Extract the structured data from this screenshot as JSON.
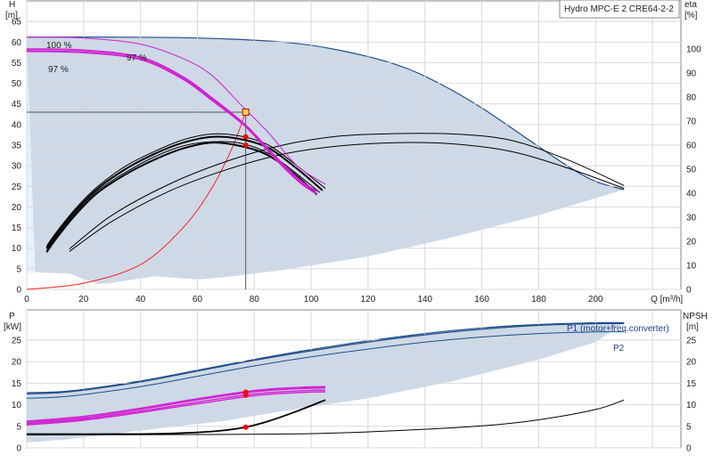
{
  "chart_data": [
    {
      "type": "line",
      "title": "Hydro MPC-E 2 CRE64-2-2",
      "xlabel": "Q [m³/h]",
      "ylabel": "H",
      "ylabel_unit": "[m]",
      "y2label": "eta",
      "y2label_unit": "[%]",
      "xlim": [
        0,
        230
      ],
      "ylim": [
        0,
        70
      ],
      "y2lim": [
        0,
        120
      ],
      "xticks": [
        "0",
        "20",
        "40",
        "60",
        "80",
        "100",
        "120",
        "140",
        "160",
        "180",
        "200",
        "Q [m³/h]"
      ],
      "yticks": [
        "0",
        "5",
        "10",
        "15",
        "20",
        "25",
        "30",
        "35",
        "40",
        "45",
        "50",
        "55",
        "60",
        "65"
      ],
      "y2ticks": [
        "0",
        "10",
        "20",
        "30",
        "40",
        "50",
        "60",
        "70",
        "80",
        "90",
        "100"
      ],
      "grid": true,
      "colors": {
        "envelope": "#cdd9e6",
        "envelope_edge": "#1f4e8c",
        "speed": "#d21fd2",
        "eff": "#000000",
        "system": "#ff2020",
        "duty": "#ffd54a"
      },
      "envelope": {
        "top": [
          [
            0,
            61.2
          ],
          [
            30,
            61.2
          ],
          [
            60,
            61
          ],
          [
            90,
            60
          ],
          [
            110,
            58
          ],
          [
            130,
            54.5
          ],
          [
            145,
            50
          ],
          [
            160,
            44
          ],
          [
            175,
            37
          ],
          [
            190,
            30
          ],
          [
            200,
            26.2
          ],
          [
            210,
            24.2
          ]
        ],
        "bottom": [
          [
            210,
            24.2
          ],
          [
            180,
            18
          ],
          [
            150,
            12.7
          ],
          [
            120,
            8
          ],
          [
            90,
            4.7
          ],
          [
            70,
            3
          ],
          [
            60,
            2.4
          ],
          [
            45,
            3.2
          ],
          [
            30,
            1.6
          ],
          [
            25,
            1.3
          ],
          [
            15,
            3.8
          ],
          [
            3,
            4.2
          ]
        ]
      },
      "speed_annotations": [
        "100 %",
        "97 %",
        "97 %"
      ],
      "speed_curves": [
        {
          "name": "100 %",
          "points": [
            [
              0,
              61.2
            ],
            [
              20,
              61
            ],
            [
              40,
              59.5
            ],
            [
              55,
              56
            ],
            [
              65,
              52
            ],
            [
              75,
              45
            ],
            [
              85,
              38
            ],
            [
              95,
              30
            ],
            [
              105,
              25.5
            ]
          ]
        },
        {
          "name": "97 %",
          "points": [
            [
              0,
              58.3
            ],
            [
              20,
              58
            ],
            [
              40,
              56.3
            ],
            [
              55,
              51.5
            ],
            [
              65,
              46.5
            ],
            [
              77,
              39.8
            ],
            [
              87,
              32.5
            ],
            [
              96,
              26.5
            ],
            [
              102,
              23.8
            ]
          ]
        },
        {
          "name": "97 %",
          "points": [
            [
              0,
              57.8
            ],
            [
              20,
              57.5
            ],
            [
              40,
              55.8
            ],
            [
              55,
              51
            ],
            [
              65,
              46
            ],
            [
              77,
              39.5
            ],
            [
              87,
              32
            ],
            [
              96,
              26
            ],
            [
              102,
              23.2
            ]
          ]
        }
      ],
      "efficiency_curves": [
        {
          "points": [
            [
              7,
              10.5
            ],
            [
              10,
              13.5
            ],
            [
              17,
              19.5
            ],
            [
              25,
              25
            ],
            [
              35,
              30
            ],
            [
              45,
              33.5
            ],
            [
              55,
              36.3
            ],
            [
              65,
              37.7
            ],
            [
              75,
              37.2
            ],
            [
              85,
              35
            ],
            [
              95,
              30
            ],
            [
              105,
              24.5
            ]
          ]
        },
        {
          "points": [
            [
              7,
              10
            ],
            [
              10,
              13
            ],
            [
              17,
              19
            ],
            [
              25,
              24.5
            ],
            [
              35,
              29.3
            ],
            [
              45,
              32.9
            ],
            [
              55,
              35.6
            ],
            [
              65,
              37
            ],
            [
              75,
              36.5
            ],
            [
              85,
              34.3
            ],
            [
              95,
              29.3
            ],
            [
              104,
              24
            ]
          ]
        },
        {
          "points": [
            [
              7,
              9.5
            ],
            [
              10,
              12.5
            ],
            [
              17,
              18.5
            ],
            [
              25,
              24
            ],
            [
              35,
              28.5
            ],
            [
              45,
              32.2
            ],
            [
              55,
              34.8
            ],
            [
              65,
              35.8
            ],
            [
              75,
              35.5
            ],
            [
              85,
              33
            ],
            [
              95,
              28
            ],
            [
              103,
              23.5
            ]
          ]
        },
        {
          "points": [
            [
              7,
              9
            ],
            [
              10,
              12
            ],
            [
              17,
              18
            ],
            [
              25,
              23.5
            ],
            [
              35,
              28
            ],
            [
              45,
              31.5
            ],
            [
              55,
              34.2
            ],
            [
              65,
              35.6
            ],
            [
              75,
              34.8
            ],
            [
              85,
              32.5
            ],
            [
              95,
              27.5
            ],
            [
              102,
              23
            ]
          ]
        },
        {
          "points": [
            [
              15,
              9.8
            ],
            [
              30,
              18
            ],
            [
              50,
              25.5
            ],
            [
              70,
              31
            ],
            [
              90,
              35
            ],
            [
              110,
              37.2
            ],
            [
              130,
              37.8
            ],
            [
              150,
              37.7
            ],
            [
              170,
              36.2
            ],
            [
              190,
              31.5
            ],
            [
              210,
              25.2
            ]
          ]
        },
        {
          "points": [
            [
              15,
              9.2
            ],
            [
              30,
              16.5
            ],
            [
              50,
              23.8
            ],
            [
              70,
              29
            ],
            [
              90,
              32.8
            ],
            [
              110,
              34.8
            ],
            [
              130,
              35.6
            ],
            [
              150,
              35.3
            ],
            [
              170,
              33.5
            ],
            [
              190,
              29.5
            ],
            [
              210,
              24.5
            ]
          ]
        }
      ],
      "system_curve": [
        [
          0,
          0
        ],
        [
          20,
          1.5
        ],
        [
          40,
          6
        ],
        [
          55,
          15
        ],
        [
          65,
          24.5
        ],
        [
          72,
          34
        ],
        [
          77,
          43
        ]
      ],
      "guide_lines": {
        "h": [
          [
            0,
            43
          ],
          [
            77,
            43
          ]
        ],
        "v": [
          [
            77,
            0
          ],
          [
            77,
            43
          ]
        ]
      },
      "operating_point": {
        "x": 77,
        "y": 43
      },
      "red_points": [
        [
          77,
          37
        ],
        [
          77,
          35
        ]
      ]
    },
    {
      "type": "line",
      "xlabel": "",
      "ylabel": "P",
      "ylabel_unit": "[kW]",
      "y2label": "NPSH",
      "y2label_unit": "[m]",
      "xlim": [
        0,
        230
      ],
      "ylim": [
        0,
        32
      ],
      "y2lim": [
        0,
        32
      ],
      "yticks": [
        "0",
        "5",
        "10",
        "15",
        "20",
        "25"
      ],
      "y2ticks": [
        "0",
        "5",
        "10",
        "15",
        "20",
        "25"
      ],
      "grid": true,
      "legend": [
        "P1 (motor+freq.converter)",
        "P2"
      ],
      "envelope": {
        "top": [
          [
            0,
            12.8
          ],
          [
            15,
            13.2
          ],
          [
            40,
            15.5
          ],
          [
            60,
            18
          ],
          [
            80,
            20.5
          ],
          [
            100,
            22.8
          ],
          [
            120,
            24.8
          ],
          [
            140,
            26.5
          ],
          [
            160,
            27.8
          ],
          [
            180,
            28.6
          ],
          [
            200,
            29
          ],
          [
            210,
            29
          ]
        ],
        "bottom": [
          [
            210,
            29
          ],
          [
            200,
            24.5
          ],
          [
            180,
            20.5
          ],
          [
            150,
            15.5
          ],
          [
            120,
            11.5
          ],
          [
            90,
            8.5
          ],
          [
            70,
            6.3
          ],
          [
            50,
            4.8
          ],
          [
            30,
            3.2
          ],
          [
            15,
            2
          ],
          [
            5,
            1.5
          ],
          [
            0,
            1.3
          ]
        ]
      },
      "p1_curve": [
        [
          0,
          12.5
        ],
        [
          15,
          13
        ],
        [
          40,
          15.3
        ],
        [
          60,
          17.8
        ],
        [
          80,
          20.3
        ],
        [
          100,
          22.5
        ],
        [
          120,
          24.5
        ],
        [
          140,
          26.2
        ],
        [
          160,
          27.5
        ],
        [
          180,
          28.4
        ],
        [
          200,
          28.8
        ],
        [
          210,
          28.8
        ]
      ],
      "p2_curve": [
        [
          0,
          11.5
        ],
        [
          15,
          12
        ],
        [
          40,
          14.2
        ],
        [
          60,
          16.6
        ],
        [
          80,
          19
        ],
        [
          100,
          21.1
        ],
        [
          120,
          22.9
        ],
        [
          140,
          24.5
        ],
        [
          160,
          25.7
        ],
        [
          180,
          26.5
        ],
        [
          200,
          26.9
        ],
        [
          210,
          26.9
        ]
      ],
      "speed_power": [
        {
          "points": [
            [
              0,
              6.2
            ],
            [
              20,
              7.3
            ],
            [
              40,
              9.2
            ],
            [
              60,
              11.4
            ],
            [
              80,
              13.3
            ],
            [
              95,
              14
            ],
            [
              105,
              14.2
            ]
          ]
        },
        {
          "points": [
            [
              0,
              5.9
            ],
            [
              20,
              7
            ],
            [
              40,
              8.9
            ],
            [
              60,
              11.1
            ],
            [
              80,
              13
            ],
            [
              95,
              13.7
            ],
            [
              105,
              13.9
            ]
          ]
        },
        {
          "points": [
            [
              0,
              5.6
            ],
            [
              20,
              6.7
            ],
            [
              40,
              8.5
            ],
            [
              60,
              10.6
            ],
            [
              80,
              12.5
            ],
            [
              95,
              13.2
            ],
            [
              105,
              13.4
            ]
          ]
        },
        {
          "points": [
            [
              0,
              5.3
            ],
            [
              20,
              6.4
            ],
            [
              40,
              8.2
            ],
            [
              60,
              10.2
            ],
            [
              80,
              12.1
            ],
            [
              95,
              12.8
            ],
            [
              105,
              13
            ]
          ]
        }
      ],
      "npsh_curves": [
        {
          "points": [
            [
              0,
              3.2
            ],
            [
              40,
              3.2
            ],
            [
              60,
              3.6
            ],
            [
              70,
              4.1
            ],
            [
              77,
              4.8
            ],
            [
              85,
              6.2
            ],
            [
              95,
              8.5
            ],
            [
              105,
              11.1
            ]
          ]
        },
        {
          "points": [
            [
              0,
              3
            ],
            [
              60,
              3.1
            ],
            [
              100,
              3.3
            ],
            [
              130,
              4
            ],
            [
              160,
              5.1
            ],
            [
              180,
              6.5
            ],
            [
              200,
              8.9
            ],
            [
              210,
              11.1
            ]
          ]
        }
      ],
      "red_points": [
        [
          77,
          12.9
        ],
        [
          77,
          12.2
        ],
        [
          77,
          4.8
        ]
      ]
    }
  ]
}
